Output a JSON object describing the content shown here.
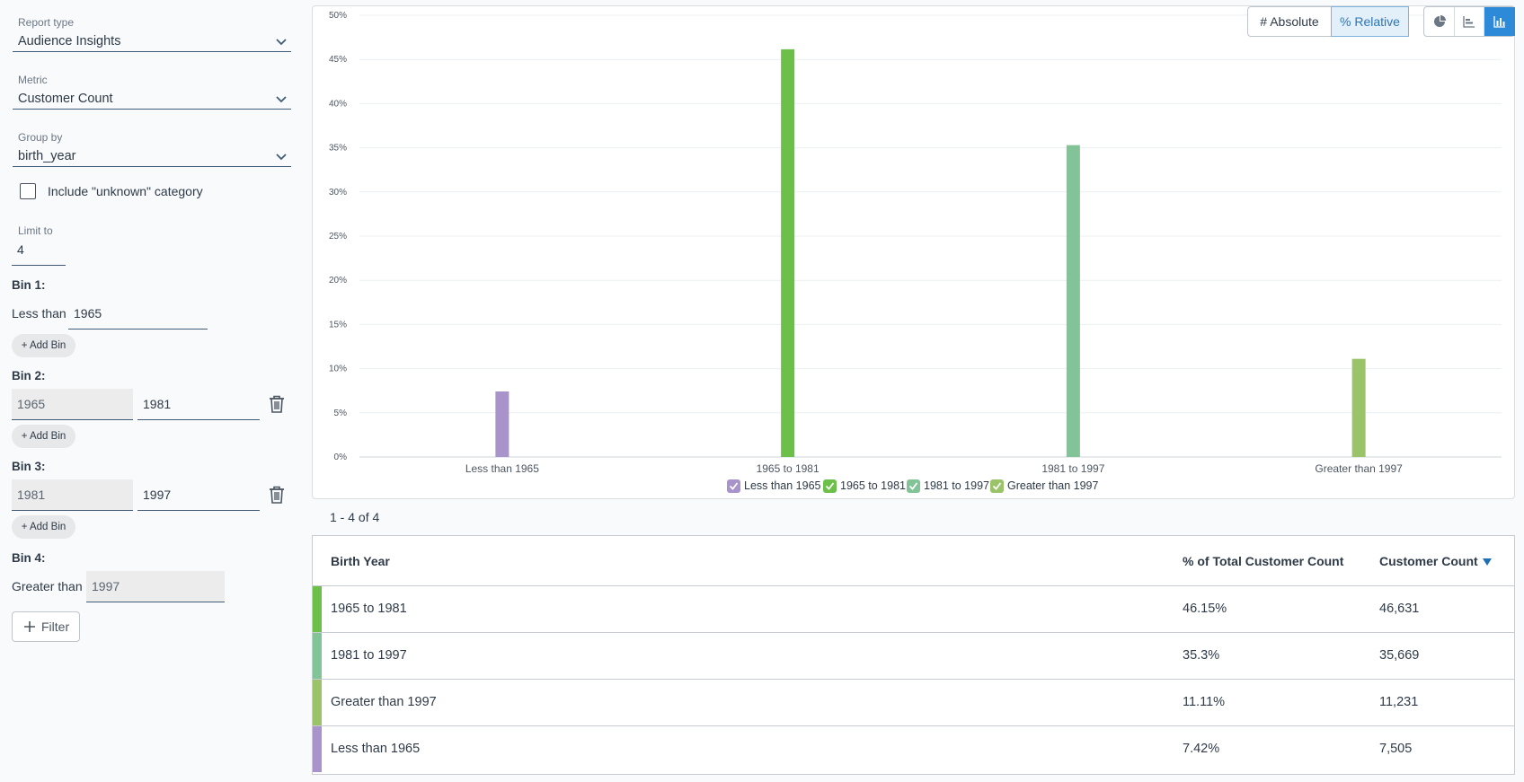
{
  "sidebar": {
    "report_type": {
      "label": "Report type",
      "value": "Audience Insights"
    },
    "metric": {
      "label": "Metric",
      "value": "Customer Count"
    },
    "group_by": {
      "label": "Group by",
      "value": "birth_year"
    },
    "include_unknown": {
      "label": "Include \"unknown\" category",
      "checked": false
    },
    "limit": {
      "label": "Limit to",
      "value": "4"
    },
    "bins": [
      {
        "title": "Bin 1:",
        "prefix": "Less than",
        "values": [
          "1965"
        ]
      },
      {
        "title": "Bin 2:",
        "values": [
          "1965",
          "1981"
        ]
      },
      {
        "title": "Bin 3:",
        "values": [
          "1981",
          "1997"
        ]
      },
      {
        "title": "Bin 4:",
        "prefix": "Greater than",
        "values": [
          "1997"
        ]
      }
    ],
    "add_bin_label": "+ Add Bin",
    "filter_label": "Filter"
  },
  "chart_toolbar": {
    "absolute_label": "# Absolute",
    "relative_label": "% Relative",
    "active_mode": "relative",
    "views": [
      "pie-chart-icon",
      "horizontal-bar-icon",
      "vertical-bar-icon"
    ],
    "active_view": "vertical-bar-icon"
  },
  "chart_data": {
    "type": "bar",
    "categories": [
      "Less than 1965",
      "1965 to 1981",
      "1981 to 1997",
      "Greater than 1997"
    ],
    "values": [
      7.42,
      46.15,
      35.3,
      11.11
    ],
    "colors": [
      "#a893ca",
      "#6cc04a",
      "#82c497",
      "#9bc36a"
    ],
    "y_ticks": [
      "0%",
      "5%",
      "10%",
      "15%",
      "20%",
      "25%",
      "30%",
      "35%",
      "40%",
      "45%",
      "50%"
    ],
    "ylim": [
      0,
      50
    ],
    "grid": true,
    "legend": [
      "Less than 1965",
      "1965 to 1981",
      "1981 to 1997",
      "Greater than 1997"
    ],
    "legend_position": "bottom"
  },
  "pager": "1 - 4 of 4",
  "table": {
    "headers": [
      "Birth Year",
      "% of Total Customer Count",
      "Customer Count"
    ],
    "rows": [
      {
        "name": "1965 to 1981",
        "pct": "46.15%",
        "count": "46,631",
        "color": "#6cc04a"
      },
      {
        "name": "1981 to 1997",
        "pct": "35.3%",
        "count": "35,669",
        "color": "#82c497"
      },
      {
        "name": "Greater than 1997",
        "pct": "11.11%",
        "count": "11,231",
        "color": "#9bc36a"
      },
      {
        "name": "Less than 1965",
        "pct": "7.42%",
        "count": "7,505",
        "color": "#a893ca"
      }
    ]
  }
}
